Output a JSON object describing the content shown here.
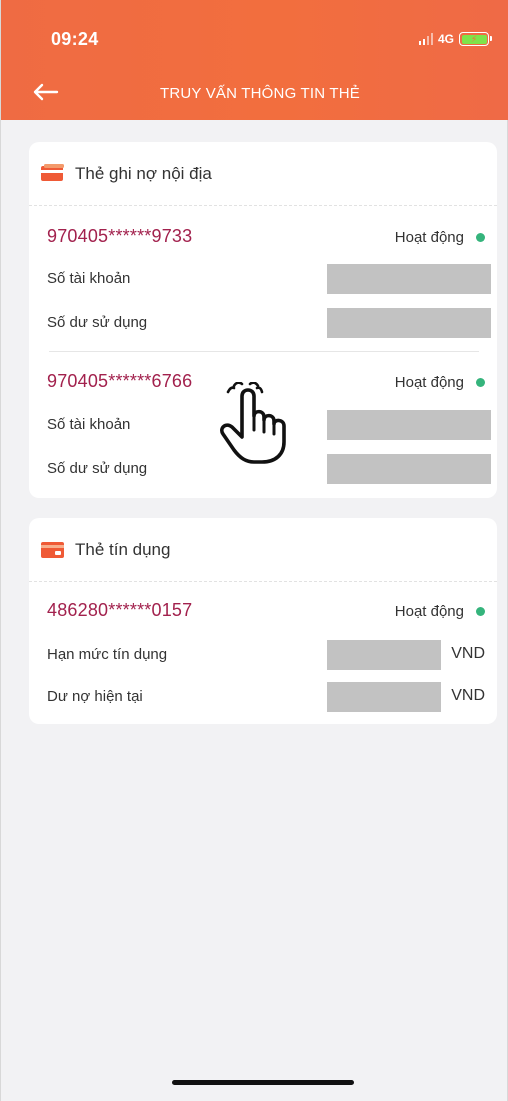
{
  "status_bar": {
    "time": "09:24",
    "network": "4G",
    "icons": [
      "signal-icon",
      "battery-charging-icon"
    ]
  },
  "nav": {
    "title": "TRUY VẤN THÔNG TIN THẺ",
    "back_icon": "arrow-left-icon"
  },
  "colors": {
    "header": "#f26e3e",
    "card_number": "#a2214d",
    "status_active": "#35b47c",
    "mask": "#c2c2c2"
  },
  "debit_section": {
    "title": "Thẻ ghi nợ nội địa",
    "icon": "debit-card-icon",
    "cards": [
      {
        "number": "970405******9733",
        "status": "Hoạt động",
        "account_label": "Số tài khoản",
        "balance_label": "Số dư sử dụng"
      },
      {
        "number": "970405******6766",
        "status": "Hoạt động",
        "account_label": "Số tài khoản",
        "balance_label": "Số dư sử dụng"
      }
    ]
  },
  "credit_section": {
    "title": "Thẻ tín dụng",
    "icon": "credit-card-icon",
    "cards": [
      {
        "number": "486280******0157",
        "status": "Hoạt động",
        "limit_label": "Hạn mức tín dụng",
        "limit_unit": "VND",
        "debt_label": "Dư nợ hiện tại",
        "debt_unit": "VND"
      }
    ]
  },
  "overlay": {
    "icon": "pointing-hand-icon"
  }
}
